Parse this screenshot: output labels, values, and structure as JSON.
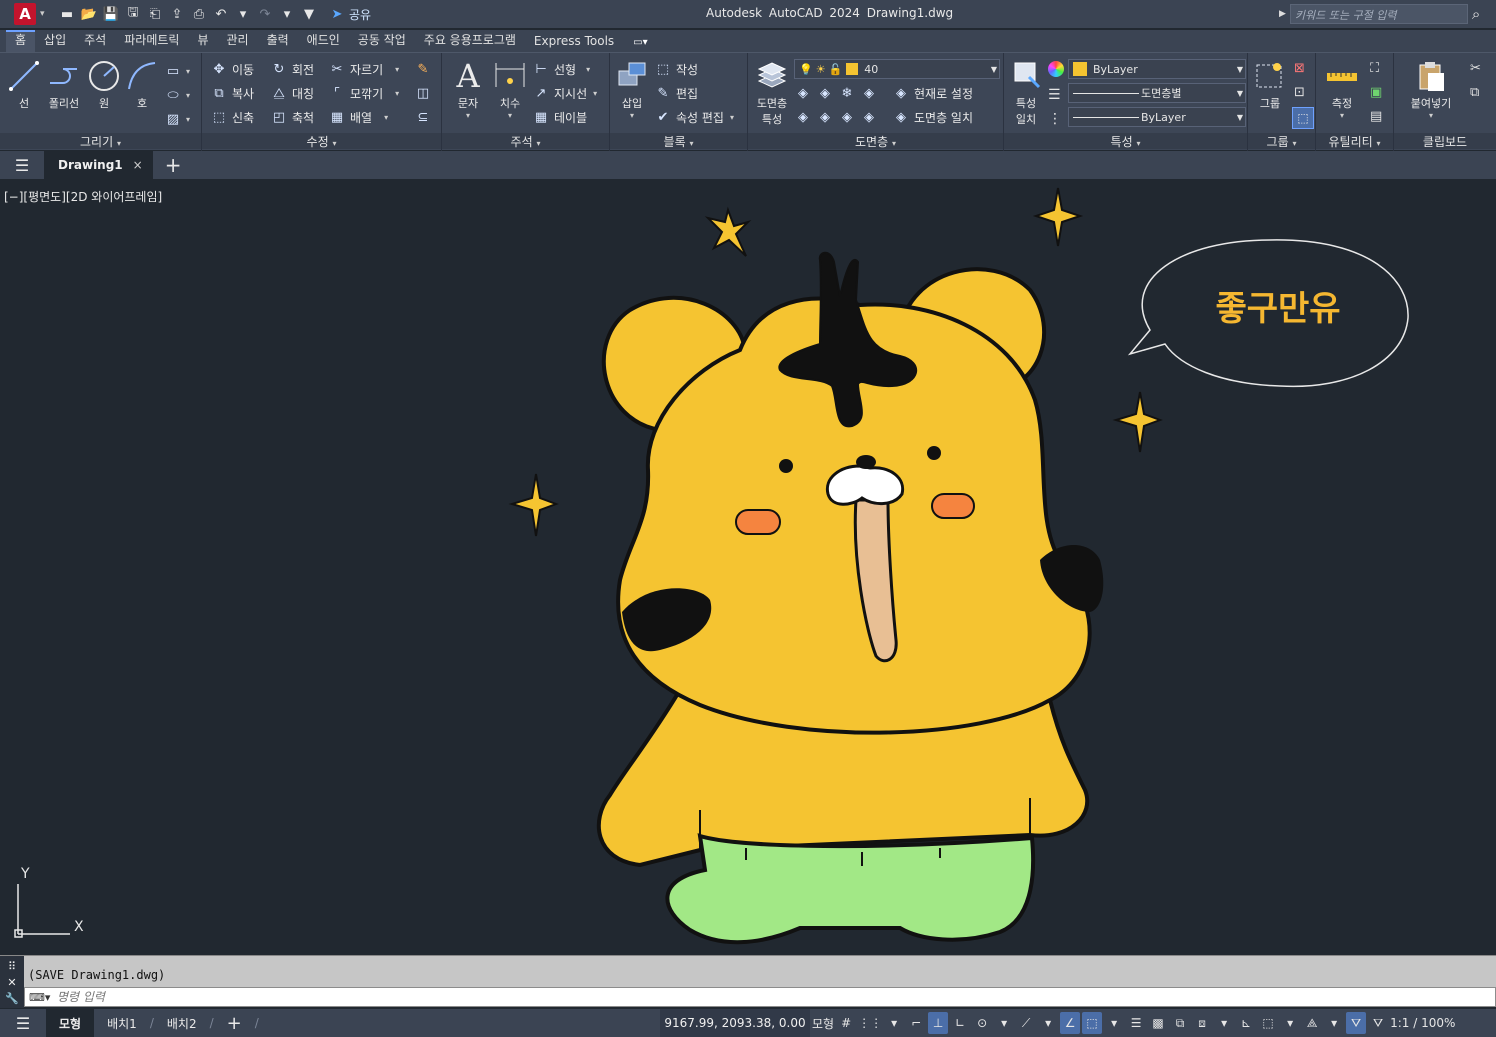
{
  "app": {
    "logo_letter": "A",
    "title": "Autodesk AutoCAD 2024",
    "document": "Drawing1.dwg"
  },
  "quick_access": {
    "share_label": "공유"
  },
  "search": {
    "placeholder": "키워드 또는 구절 입력"
  },
  "ribbon_tabs": [
    "홈",
    "삽입",
    "주석",
    "파라메트릭",
    "뷰",
    "관리",
    "출력",
    "애드인",
    "공동 작업",
    "주요 응용프로그램",
    "Express Tools"
  ],
  "ribbon": {
    "draw": {
      "title": "그리기",
      "line": "선",
      "polyline": "폴리선",
      "circle": "원",
      "arc": "호"
    },
    "modify": {
      "title": "수정",
      "move": "이동",
      "rotate": "회전",
      "trim": "자르기",
      "copy": "복사",
      "mirror": "대칭",
      "fillet": "모깎기",
      "stretch": "신축",
      "scale": "축척",
      "array": "배열"
    },
    "annotation": {
      "title": "주석",
      "text": "문자",
      "dimension": "치수",
      "linear": "선형",
      "leader": "지시선",
      "table": "테이블"
    },
    "block": {
      "title": "블록",
      "insert": "삽입",
      "create": "작성",
      "edit": "편집",
      "edit_attributes": "속성 편집"
    },
    "layers": {
      "title": "도면층",
      "properties_line1": "도면층",
      "properties_line2": "특성",
      "current_layer": "40",
      "set_current": "현재로 설정",
      "match_layer": "도면층 일치"
    },
    "properties": {
      "title": "특성",
      "match_line1": "특성",
      "match_line2": "일치",
      "color": "ByLayer",
      "linetype": "도면층별",
      "lineweight": "ByLayer",
      "color_hex": "#f5c431"
    },
    "groups": {
      "title": "그룹",
      "group": "그룹"
    },
    "utilities": {
      "title": "유틸리티",
      "measure": "측정"
    },
    "clipboard": {
      "title": "클립보드",
      "paste": "붙여넣기"
    }
  },
  "doc_tab": {
    "name": "Drawing1",
    "close": "×"
  },
  "viewport": {
    "label": "[−][평면도][2D 와이어프레임]",
    "speech_text": "좋구만유",
    "ucs_x": "X",
    "ucs_y": "Y",
    "colors": {
      "background": "#212830",
      "body": "#f5c431",
      "pants": "#a2e886",
      "nose": "#e8bf94",
      "cheek": "#f5843f",
      "star": "#f5c431",
      "speech_text": "#f5b731"
    }
  },
  "command": {
    "history": "(SAVE Drawing1.dwg)",
    "placeholder": "명령 입력"
  },
  "status": {
    "layout_tabs": [
      "모형",
      "배치1",
      "배치2"
    ],
    "coords": "9167.99, 2093.38, 0.00",
    "model": "모형",
    "scale": "1:1 / 100%"
  }
}
